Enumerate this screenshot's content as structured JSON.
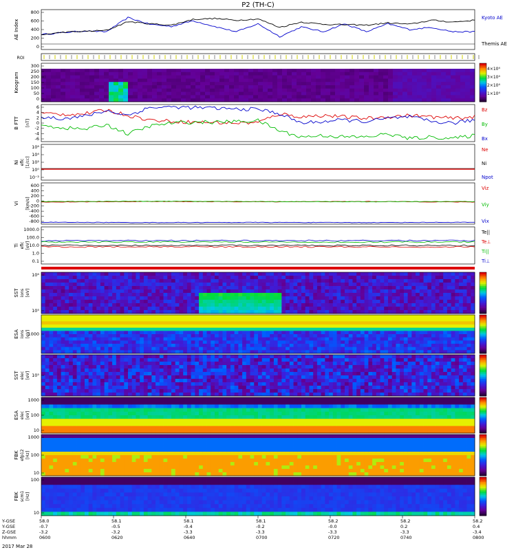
{
  "title": "P2 (TH-C)",
  "date_label": "2017 Mar 28",
  "colors": {
    "kyoto": "#0000cc",
    "themis": "#000000",
    "red": "#dd0000",
    "green": "#00bb00",
    "blue": "#0000cc",
    "black": "#000000"
  },
  "chart_data": [
    {
      "type": "line",
      "panel": "ae",
      "ylabel": "AE Index",
      "yticks": [
        "800",
        "600",
        "400",
        "200",
        "0"
      ],
      "ylim": [
        -100,
        800
      ],
      "x": [
        0,
        0.05,
        0.1,
        0.15,
        0.2,
        0.25,
        0.3,
        0.35,
        0.4,
        0.45,
        0.5,
        0.55,
        0.6,
        0.65,
        0.7,
        0.75,
        0.8,
        0.85,
        0.9,
        0.95,
        1
      ],
      "series": [
        {
          "name": "Kyoto AE",
          "color": "#0000cc",
          "values": [
            240,
            280,
            320,
            300,
            620,
            470,
            420,
            550,
            420,
            300,
            480,
            190,
            410,
            300,
            480,
            300,
            480,
            350,
            400,
            300,
            300
          ]
        },
        {
          "name": "Themis AE",
          "color": "#000000",
          "values": [
            230,
            290,
            310,
            330,
            530,
            480,
            450,
            580,
            600,
            560,
            590,
            400,
            520,
            470,
            460,
            450,
            500,
            470,
            560,
            520,
            560
          ]
        }
      ]
    },
    {
      "type": "strip",
      "panel": "roi",
      "ylabel": "ROI"
    },
    {
      "type": "heatmap",
      "panel": "keogram",
      "ylabel": "Keogram",
      "yticks": [
        "300",
        "250",
        "200",
        "150",
        "100",
        "50",
        "0"
      ],
      "colorbar_ticks": [
        "4×10⁴",
        "3×10⁴",
        "2×10⁴",
        "1×10⁴"
      ],
      "colorbar_label": "[counts]"
    },
    {
      "type": "line",
      "panel": "bfield",
      "ylabel": "B FTT",
      "yunit": "[nT]",
      "yticks": [
        "6",
        "4",
        "2",
        "0",
        "-2",
        "-4",
        "-6"
      ],
      "ylim": [
        -6,
        6
      ],
      "x": [
        0,
        0.05,
        0.1,
        0.15,
        0.2,
        0.25,
        0.3,
        0.35,
        0.4,
        0.45,
        0.5,
        0.55,
        0.6,
        0.65,
        0.7,
        0.75,
        0.8,
        0.85,
        0.9,
        0.95,
        1
      ],
      "series": [
        {
          "name": "Bz",
          "color": "#dd0000",
          "values": [
            3.2,
            2.8,
            3.0,
            4.2,
            2.5,
            1.0,
            0.6,
            0.3,
            0.2,
            0.0,
            0.2,
            3.0,
            2.0,
            2.5,
            2.0,
            1.5,
            2.0,
            2.5,
            2.0,
            1.5,
            2.0
          ]
        },
        {
          "name": "By",
          "color": "#00bb00",
          "values": [
            -0.8,
            -1.5,
            -2.0,
            -0.5,
            -3.5,
            -1.0,
            0.0,
            0.3,
            0.3,
            0.5,
            0.8,
            -2.5,
            -4.5,
            -4.0,
            -4.5,
            -4.5,
            -3.5,
            -5.0,
            -4.5,
            -5.0,
            -4.0
          ]
        },
        {
          "name": "Bx",
          "color": "#0000cc",
          "values": [
            2.0,
            1.5,
            2.2,
            4.0,
            2.5,
            5.0,
            5.2,
            5.0,
            4.8,
            4.5,
            4.5,
            3.0,
            0.0,
            0.5,
            1.0,
            0.5,
            1.5,
            2.0,
            0.5,
            0.0,
            1.0
          ]
        }
      ]
    },
    {
      "type": "line",
      "panel": "density",
      "ylabel": "Ni",
      "yunit": "[1/cc]",
      "ylabel2": "eflc",
      "yticks": [
        "10⁶",
        "10⁴",
        "10²",
        "10⁰",
        "10⁻²"
      ],
      "legend": [
        "Ne",
        "Ni",
        "Npot"
      ],
      "series": [
        {
          "name": "Ne",
          "color": "#dd0000",
          "values": [
            0.2,
            0.2,
            0.2,
            0.2,
            0.2
          ]
        },
        {
          "name": "Ni",
          "color": "#000000",
          "values": [
            0.2,
            0.2,
            0.2,
            0.2,
            0.2
          ]
        },
        {
          "name": "Npot",
          "color": "#0000cc",
          "values": [
            0.2,
            0.2,
            0.2,
            0.2,
            0.2
          ]
        }
      ]
    },
    {
      "type": "line",
      "panel": "velocity",
      "ylabel": "Vi",
      "yunit": "[km/s]",
      "yticks": [
        "600",
        "400",
        "200",
        "0",
        "-200",
        "-400",
        "-600",
        "-800"
      ],
      "ylim": [
        -850,
        700
      ],
      "x": [
        0,
        0.25,
        0.5,
        0.75,
        1
      ],
      "series": [
        {
          "name": "Viz",
          "color": "#dd0000",
          "values": [
            -20,
            0,
            -10,
            0,
            -20
          ]
        },
        {
          "name": "Viy",
          "color": "#00bb00",
          "values": [
            0,
            10,
            0,
            -10,
            0
          ]
        },
        {
          "name": "Vix",
          "color": "#0000cc",
          "values": [
            -780,
            -790,
            -785,
            -790,
            -780
          ]
        }
      ]
    },
    {
      "type": "line",
      "panel": "temperature",
      "ylabel": "Ti",
      "yunit": "[eV]",
      "ylabel2": "eflc",
      "yticks": [
        "1000.0",
        "100.0",
        "10.0",
        "1.0",
        "0.1"
      ],
      "legend": [
        "Te||",
        "Te⊥",
        "Ti||",
        "Ti⊥"
      ],
      "series": [
        {
          "name": "Te||",
          "color": "#000000",
          "values": [
            30,
            30,
            30,
            30,
            30
          ]
        },
        {
          "name": "Te⊥",
          "color": "#dd0000",
          "values": [
            20,
            20,
            20,
            20,
            20
          ]
        },
        {
          "name": "Ti||",
          "color": "#00bb00",
          "values": [
            60,
            60,
            60,
            60,
            60
          ]
        },
        {
          "name": "Ti⊥",
          "color": "#0000cc",
          "values": [
            50,
            50,
            50,
            50,
            50
          ]
        }
      ]
    },
    {
      "type": "heatmap",
      "panel": "sst_i",
      "ylabel": "SST",
      "yunit": "[eV]",
      "ylabel2": "ions",
      "yticks": [
        "10⁶",
        "10⁵"
      ],
      "colorbar_label": "Eflux, EFU",
      "colorbar_ticks": [
        "10⁸",
        "10⁷",
        "10⁶",
        "10⁵",
        "10⁴"
      ]
    },
    {
      "type": "heatmap",
      "panel": "esa_i",
      "ylabel": "ESA",
      "yunit": "[eV]",
      "ylabel2": "ions",
      "yticks": [
        "1000"
      ],
      "colorbar_label": "Eflux, EFU",
      "colorbar_ticks": [
        "10⁸",
        "10⁷",
        "10⁶",
        "10⁵",
        "10⁴",
        "10³"
      ]
    },
    {
      "type": "heatmap",
      "panel": "sst_e",
      "ylabel": "SST",
      "yunit": "[eV]",
      "ylabel2": "elec",
      "yticks": [
        "10⁵"
      ],
      "colorbar_label": "Eflux, EFU",
      "colorbar_ticks": [
        "10⁸",
        "10⁷",
        "10⁶",
        "10⁵",
        "10⁴",
        "10³",
        "10²"
      ]
    },
    {
      "type": "heatmap",
      "panel": "esa_e",
      "ylabel": "ESA",
      "yunit": "[eV]",
      "ylabel2": "elec",
      "yticks": [
        "1000",
        "100",
        "10"
      ],
      "colorbar_label": "Eflux, EFU",
      "colorbar_ticks": [
        "10⁸",
        "10⁷",
        "10⁶",
        "10⁵",
        "10⁴",
        "10³"
      ]
    },
    {
      "type": "heatmap",
      "panel": "fbk_e",
      "ylabel": "FBK",
      "yunit": "[Hz]",
      "ylabel2": "efp12",
      "yticks": [
        "1000",
        "100",
        "10"
      ],
      "colorbar_label": "<|mV/m|>",
      "colorbar_ticks": [
        "1.00",
        "0.10",
        "0.01"
      ]
    },
    {
      "type": "heatmap",
      "panel": "fbk_b",
      "ylabel": "FBK",
      "yunit": "[Hz]",
      "ylabel2": "scm1",
      "yticks": [
        "100",
        "10"
      ],
      "colorbar_label": "<|nT|>",
      "colorbar_ticks": [
        "1.000",
        "0.100",
        "0.010",
        "0.001"
      ]
    }
  ],
  "xaxis": {
    "row_labels": [
      "Y-GSE",
      "Y-GSE",
      "Z-GSE",
      "hhmm"
    ],
    "columns": [
      {
        "v": [
          "58.0",
          "-0.7",
          "-3.2",
          "0600"
        ]
      },
      {
        "v": [
          "58.1",
          "-0.5",
          "-3.2",
          "0620"
        ]
      },
      {
        "v": [
          "58.1",
          "-0.4",
          "-3.3",
          "0640"
        ]
      },
      {
        "v": [
          "58.1",
          "-0.2",
          "-3.3",
          "0700"
        ]
      },
      {
        "v": [
          "58.2",
          "-0.0",
          "-3.3",
          "0720"
        ]
      },
      {
        "v": [
          "58.2",
          "0.2",
          "-3.3",
          "0740"
        ]
      },
      {
        "v": [
          "58.2",
          "0.4",
          "-3.4",
          "0800"
        ]
      }
    ]
  }
}
